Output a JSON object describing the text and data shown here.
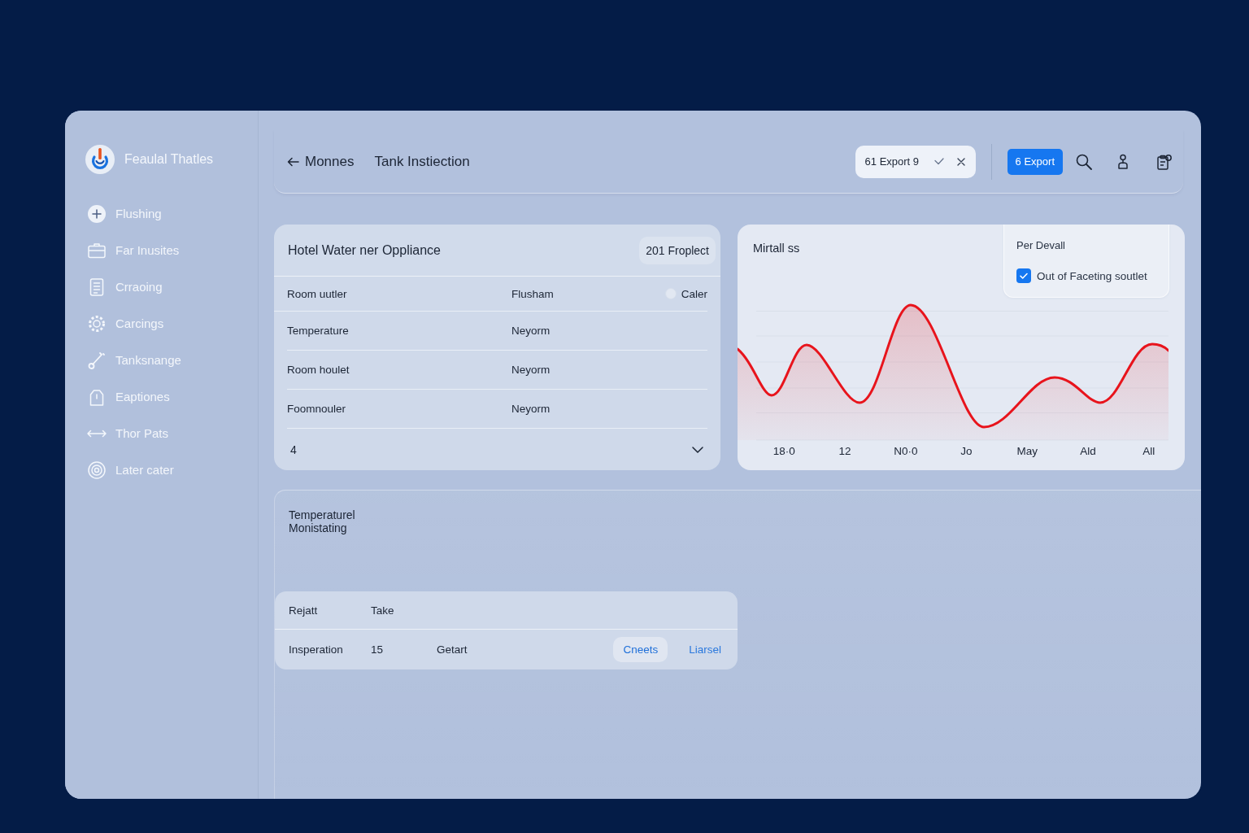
{
  "sidebar": {
    "app_name": "Feaulal Thatles",
    "items": [
      {
        "label": "Flushing"
      },
      {
        "label": "Far Inusites"
      },
      {
        "label": "Crraoing"
      },
      {
        "label": "Carcings"
      },
      {
        "label": "Tanksnange"
      },
      {
        "label": "Eaptiones"
      },
      {
        "label": "Thor Pats"
      },
      {
        "label": "Later cater"
      }
    ]
  },
  "header": {
    "back_label": "Monnes",
    "title": "Tank Instiection",
    "filter_chip": "61 Export 9",
    "export_button": "6 Export"
  },
  "appliance_card": {
    "title": "Hotel Water ner Oppliance",
    "badge": "201 Froplect",
    "rows": [
      {
        "cells": [
          "Room uutler",
          "Flusham"
        ],
        "option": {
          "label": "Caler",
          "selected": false
        }
      },
      {
        "cells": [
          "Temperature",
          "Neyorm"
        ]
      },
      {
        "cells": [
          "Room houlet",
          "Neyorm"
        ]
      },
      {
        "cells": [
          "Foomnouler",
          "Neyorm"
        ]
      }
    ],
    "footer_count": "4"
  },
  "chart_card": {
    "title": "Mirtall ss",
    "legend": {
      "title": "Per Devall",
      "option": {
        "label": "Out of Faceting soutlet",
        "checked": true
      }
    },
    "x_labels": [
      "18·0",
      "12",
      "N0·0",
      "Jo",
      "May",
      "Ald",
      "All"
    ]
  },
  "monitoring": {
    "title": "Temperaturel Monistating",
    "table": {
      "columns": [
        "Rejatt",
        "Take"
      ],
      "rows": [
        {
          "cells": [
            "Insperation",
            "15",
            "Getart"
          ],
          "actions": [
            {
              "label": "Cneets",
              "kind": "button"
            },
            {
              "label": "Liarsel",
              "kind": "link"
            }
          ]
        }
      ]
    }
  }
}
